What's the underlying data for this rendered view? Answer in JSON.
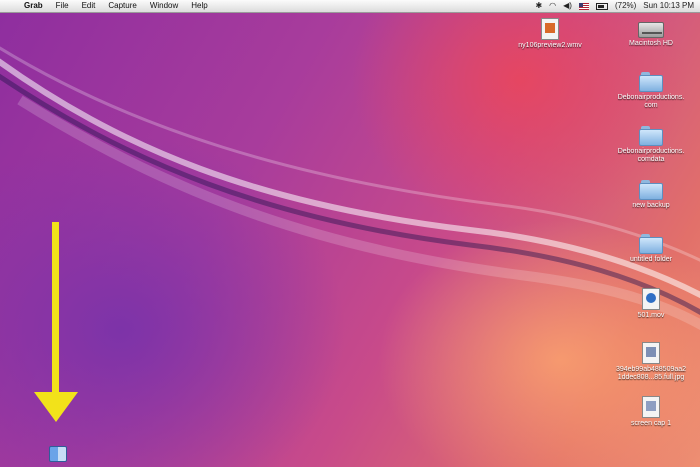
{
  "menubar": {
    "apple_glyph": "",
    "app_name": "Grab",
    "menus": [
      "File",
      "Edit",
      "Capture",
      "Window",
      "Help"
    ],
    "battery_text": "(72%)",
    "clock": "Sun 10:13 PM"
  },
  "desktop_icons": [
    {
      "label": "ny106preview2.wmv",
      "icon": "video-file-icon"
    },
    {
      "label": "Macintosh HD",
      "icon": "hard-drive-icon"
    },
    {
      "label_line1": "Debonairproductions.",
      "label_line2": "com",
      "icon": "folder-icon"
    },
    {
      "label_line1": "Debonairproductions.",
      "label_line2": "comdata",
      "icon": "folder-icon"
    },
    {
      "label": "new backup",
      "icon": "folder-icon"
    },
    {
      "label": "untitled folder",
      "icon": "folder-icon"
    },
    {
      "label": "501.mov",
      "icon": "quicktime-file-icon"
    },
    {
      "label_line1": "394eb99ab488509aa2",
      "label_line2": "1ddec808...85.full.jpg",
      "icon": "jpeg-file-icon"
    },
    {
      "label": "screen cap 1",
      "icon": "tiff-file-icon"
    }
  ],
  "colors": {
    "arrow": "#f2e21a",
    "menubar": "#e9e9e9"
  }
}
